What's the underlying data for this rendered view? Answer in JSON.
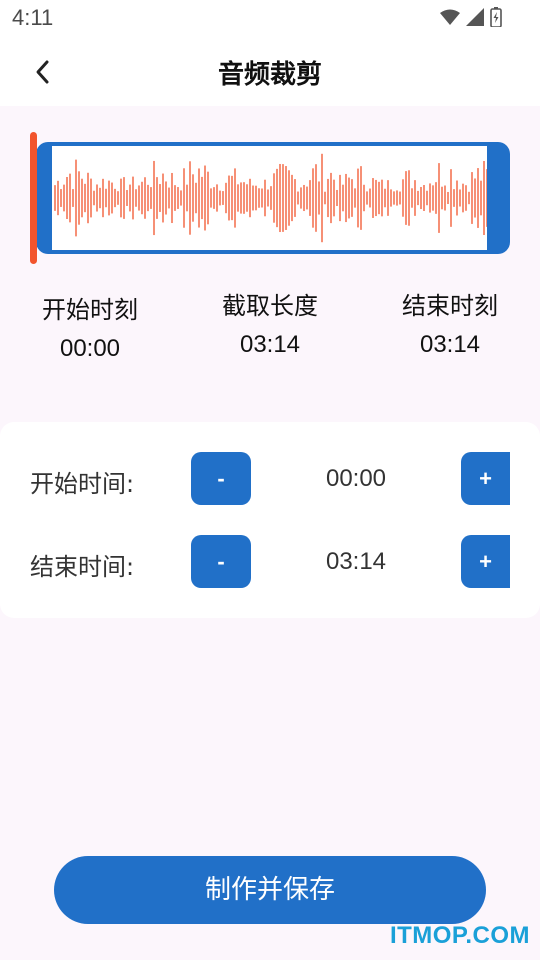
{
  "status_bar": {
    "time": "4:11",
    "icons": [
      "wifi-icon",
      "signal-icon",
      "battery-icon"
    ]
  },
  "header": {
    "back_icon": "chevron-left-icon",
    "title": "音频裁剪"
  },
  "waveform": {
    "frame_color": "#2170c8",
    "wave_color": "#f2542d",
    "handle_color": "#f2542d"
  },
  "summary": {
    "start": {
      "label": "开始时刻",
      "value": "00:00"
    },
    "duration": {
      "label": "截取长度",
      "value": "03:14"
    },
    "end": {
      "label": "结束时刻",
      "value": "03:14"
    }
  },
  "controls": {
    "start": {
      "label": "开始时间:",
      "minus": "-",
      "value": "00:00",
      "plus": "+"
    },
    "end": {
      "label": "结束时间:",
      "minus": "-",
      "value": "03:14",
      "plus": "+"
    }
  },
  "actions": {
    "save_label": "制作并保存"
  },
  "watermark": "ITMOP.COM",
  "colors": {
    "accent": "#2170c8",
    "background": "#fcf6fc",
    "wave": "#f2542d"
  }
}
